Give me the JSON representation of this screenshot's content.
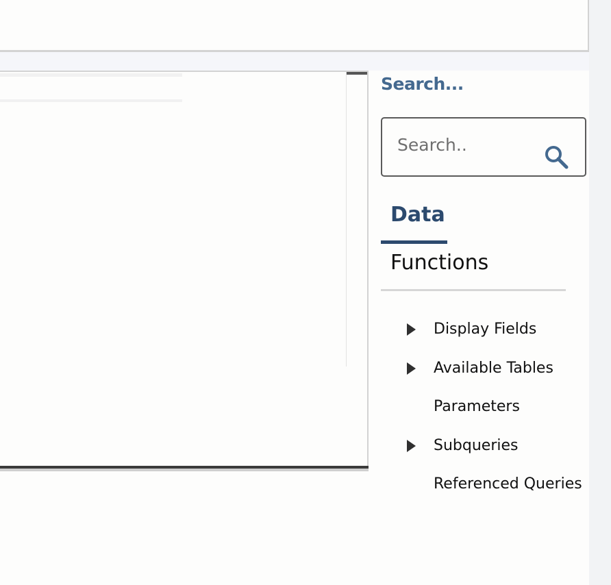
{
  "sidebar": {
    "title": "Search...",
    "search": {
      "placeholder": "Search..",
      "value": ""
    },
    "tabs": [
      {
        "label": "Data",
        "active": true
      },
      {
        "label": "Functions",
        "active": false
      }
    ],
    "tree": [
      {
        "label": "Display Fields",
        "expandable": true
      },
      {
        "label": "Available Tables",
        "expandable": true
      },
      {
        "label": "Parameters",
        "expandable": false
      },
      {
        "label": "Subqueries",
        "expandable": true
      },
      {
        "label": "Referenced Queries",
        "expandable": false
      }
    ]
  },
  "colors": {
    "accent": "#2c4a6e",
    "title": "#44698f",
    "search_icon": "#44698f"
  }
}
